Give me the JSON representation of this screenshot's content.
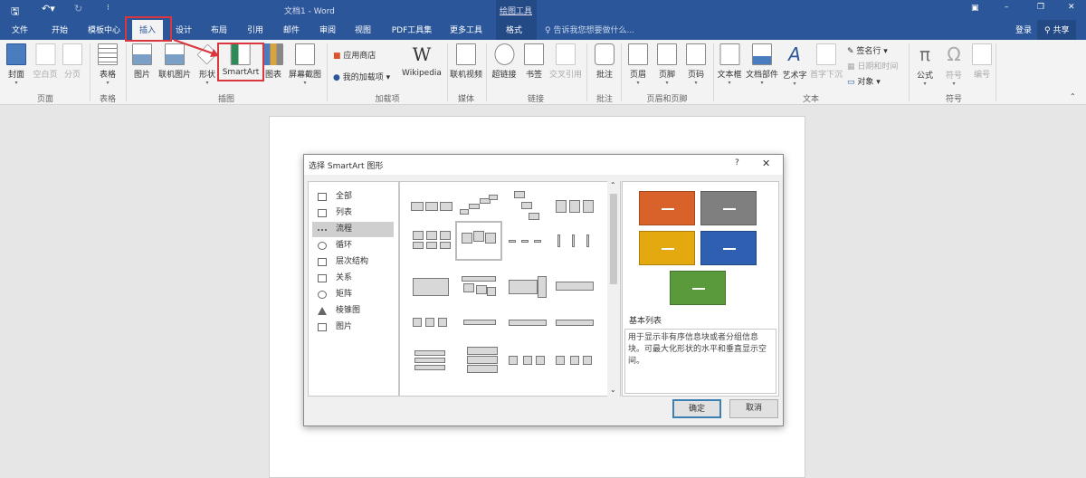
{
  "window": {
    "title": "文档1 - Word",
    "context_tab_group": "绘图工具",
    "search_placeholder": "告诉我您想要做什么...",
    "login": "登录",
    "share": "共享"
  },
  "tabs": [
    "文件",
    "开始",
    "模板中心",
    "插入",
    "设计",
    "布局",
    "引用",
    "邮件",
    "审阅",
    "视图",
    "PDF工具集",
    "更多工具",
    "格式"
  ],
  "active_tab": "插入",
  "ribbon": {
    "buttons": [
      "封面",
      "空白页",
      "分页",
      "表格",
      "图片",
      "联机图片",
      "形状",
      "SmartArt",
      "图表",
      "屏幕截图",
      "Wikipedia",
      "联机视频",
      "超链接",
      "书签",
      "交叉引用",
      "批注",
      "页眉",
      "页脚",
      "页码",
      "文本框",
      "文档部件",
      "艺术字",
      "首字下沉",
      "公式",
      "符号",
      "编号"
    ],
    "small": [
      "应用商店",
      "我的加载项",
      "签名行",
      "日期和时间",
      "对象"
    ],
    "groups": [
      "页面",
      "表格",
      "插图",
      "加载项",
      "媒体",
      "链接",
      "批注",
      "页眉和页脚",
      "文本",
      "符号"
    ]
  },
  "dialog": {
    "title": "选择 SmartArt 图形",
    "help": "?",
    "close": "✕",
    "categories": [
      "全部",
      "列表",
      "流程",
      "循环",
      "层次结构",
      "关系",
      "矩阵",
      "棱锥图",
      "图片"
    ],
    "selected_category": "流程",
    "preview_title": "基本列表",
    "preview_desc": "用于显示非有序信息块或者分组信息块。可最大化形状的水平和垂直显示空间。",
    "preview_colors": [
      "#d9622b",
      "#7f7f7f",
      "#e3a90f",
      "#2f5fb0",
      "#5a9a3c"
    ],
    "ok": "确定",
    "cancel": "取消"
  }
}
